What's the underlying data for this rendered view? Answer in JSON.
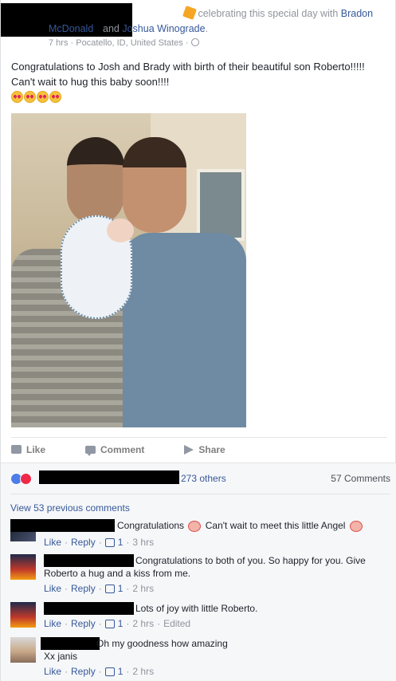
{
  "header": {
    "celebrating_text": "celebrating this special day with",
    "with_name_1": "Bradon McDonald",
    "and_text": "and",
    "with_name_2": "Joshua Winograde",
    "period": ".",
    "time": "7 hrs",
    "location": "Pocatello, ID, United States",
    "separator": "·"
  },
  "post": {
    "text": "Congratulations to Josh and Brady with birth of their beautiful son Roberto!!!!! Can't wait to hug this baby soon!!!!",
    "emoji_icon": "heart-eyes-emoji"
  },
  "actions": {
    "like": "Like",
    "comment": "Comment",
    "share": "Share"
  },
  "feedback": {
    "others": "273 others",
    "comments_count": "57 Comments",
    "view_previous": "View 53 previous comments"
  },
  "comments": [
    {
      "text_before": "Congratulations",
      "text_after": "Can't wait to meet this little Angel",
      "like": "Like",
      "reply": "Reply",
      "likes": "1",
      "time": "3 hrs"
    },
    {
      "text_line1": "Congratulations to both of you. So happy for you. Give",
      "text_line2": "Roberto a hug and a kiss from me.",
      "like": "Like",
      "reply": "Reply",
      "likes": "1",
      "time": "2 hrs"
    },
    {
      "text": "Lots of joy with little Roberto.",
      "like": "Like",
      "reply": "Reply",
      "likes": "1",
      "time": "2 hrs",
      "edited": "Edited"
    },
    {
      "text_line1": "Oh my goodness how amazing",
      "text_line2": "Xx janis",
      "like": "Like",
      "reply": "Reply",
      "likes": "1",
      "time": "2 hrs"
    }
  ],
  "colors": {
    "link": "#365899",
    "muted": "#90949c",
    "like_reaction": "#4c7de8",
    "love_reaction": "#f0284a"
  }
}
